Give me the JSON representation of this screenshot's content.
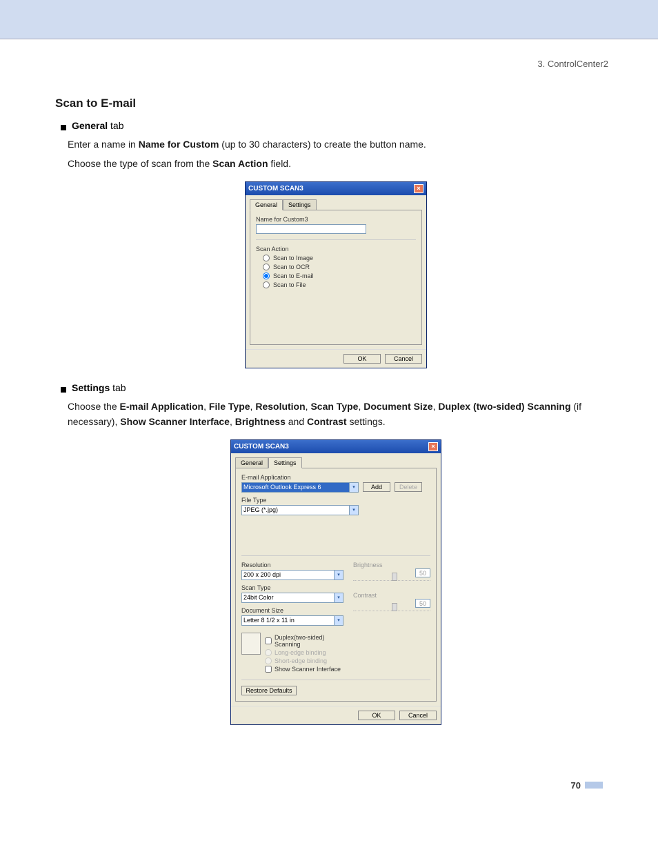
{
  "breadcrumb": "3. ControlCenter2",
  "heading": "Scan to E-mail",
  "bullet1": {
    "label": "General",
    "suffix": " tab"
  },
  "para1_pre": "Enter a name in ",
  "para1_bold": "Name for Custom",
  "para1_post": " (up to 30 characters) to create the button name.",
  "para2_pre": "Choose the type of scan from the ",
  "para2_bold": "Scan Action",
  "para2_post": " field.",
  "bullet2": {
    "label": "Settings",
    "suffix": " tab"
  },
  "para3": {
    "t0": "Choose the ",
    "b0": "E-mail Application",
    "t1": ", ",
    "b1": "File Type",
    "t2": ", ",
    "b2": "Resolution",
    "t3": ", ",
    "b3": "Scan Type",
    "t4": ", ",
    "b4": "Document Size",
    "t5": ", ",
    "b5": "Duplex (two-sided) Scanning",
    "t6": " (if necessary), ",
    "b6": "Show Scanner Interface",
    "t7": ", ",
    "b7": "Brightness",
    "t8": " and ",
    "b8": "Contrast",
    "t9": " settings."
  },
  "dlg1": {
    "title": "CUSTOM SCAN3",
    "tab_general": "General",
    "tab_settings": "Settings",
    "name_label": "Name for Custom3",
    "scan_action_label": "Scan Action",
    "r1": "Scan to Image",
    "r2": "Scan to OCR",
    "r3": "Scan to E-mail",
    "r4": "Scan to File",
    "ok": "OK",
    "cancel": "Cancel"
  },
  "dlg2": {
    "title": "CUSTOM SCAN3",
    "tab_general": "General",
    "tab_settings": "Settings",
    "email_label": "E-mail Application",
    "email_value": "Microsoft Outlook Express 6",
    "add": "Add",
    "delete": "Delete",
    "filetype_label": "File Type",
    "filetype_value": "JPEG (*.jpg)",
    "res_label": "Resolution",
    "res_value": "200 x 200 dpi",
    "scantype_label": "Scan Type",
    "scantype_value": "24bit Color",
    "docsize_label": "Document Size",
    "docsize_value": "Letter 8 1/2 x 11 in",
    "bright_label": "Brightness",
    "bright_value": "50",
    "contrast_label": "Contrast",
    "contrast_value": "50",
    "duplex": "Duplex(two-sided) Scanning",
    "longedge": "Long-edge binding",
    "shortedge": "Short-edge binding",
    "showscanner": "Show Scanner Interface",
    "restore": "Restore Defaults",
    "ok": "OK",
    "cancel": "Cancel"
  },
  "page_number": "70"
}
